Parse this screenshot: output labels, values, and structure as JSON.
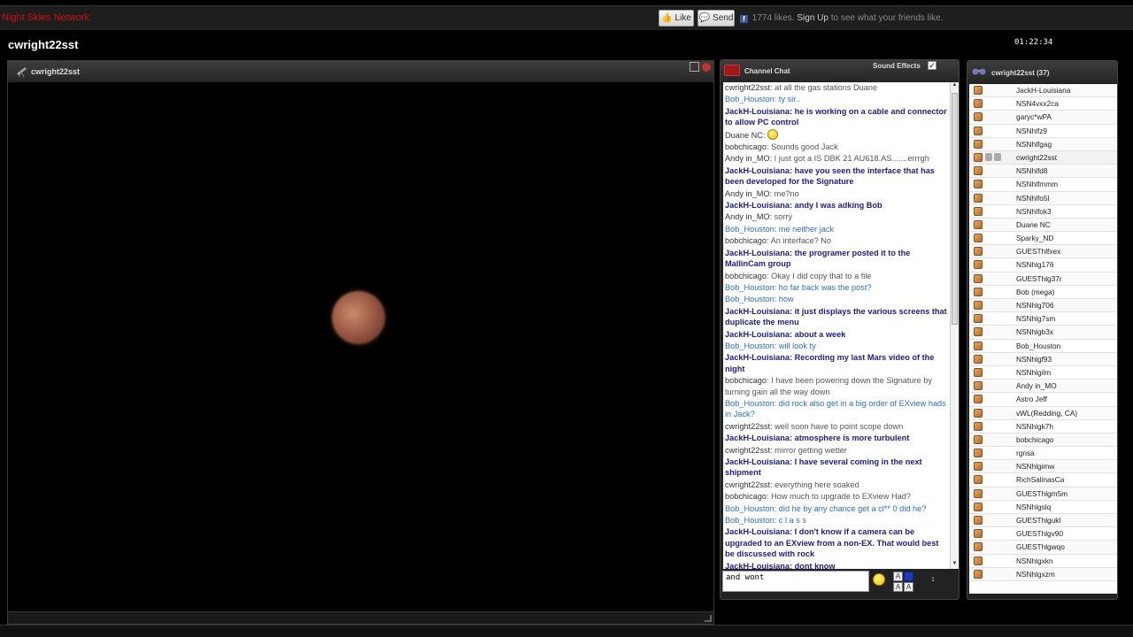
{
  "site_title": "Night Skies Network",
  "topbar": {
    "like_label": "Like",
    "send_label": "Send",
    "likes_text": "1774 likes.",
    "signup_label": "Sign Up",
    "signup_suffix": "to see what your friends like."
  },
  "channel": {
    "name": "cwright22sst",
    "clock": "01:22:34"
  },
  "video": {
    "username": "cwright22sst"
  },
  "chat": {
    "title": "Channel Chat",
    "sound_effects_label": "Sound Effects",
    "sound_effects_checked": "✓",
    "input_value": "and wont",
    "counter": "1",
    "messages": [
      {
        "user": "cwright22sst",
        "text": ": at all the gas stations Duane",
        "style": "dark"
      },
      {
        "user": "Bob_Houston",
        "text": ": ty sir..",
        "style": "blue"
      },
      {
        "user": "JackH-Louisiana",
        "text": ": he is working on a cable and connector to allow PC control",
        "style": "navy"
      },
      {
        "user": "Duane NC",
        "text": ":",
        "style": "dark",
        "emoji": true
      },
      {
        "user": "bobchicago",
        "text": ": Sounds good Jack",
        "style": "dark"
      },
      {
        "user": "Andy in_MO",
        "text": ": I just got a IS DBK 21 AU618.AS.......errrgh",
        "style": "dark"
      },
      {
        "user": "JackH-Louisiana",
        "text": ": have you seen the interface that has been developed for the Signature",
        "style": "navy"
      },
      {
        "user": "Andy in_MO",
        "text": ": me?no",
        "style": "dark"
      },
      {
        "user": "JackH-Louisiana",
        "text": ": andy I was adking Bob",
        "style": "navy"
      },
      {
        "user": "Andy in_MO",
        "text": ": sorry",
        "style": "dark"
      },
      {
        "user": "Bob_Houston",
        "text": ": me neither jack",
        "style": "blue"
      },
      {
        "user": "bobchicago",
        "text": ": An interface? No",
        "style": "dark"
      },
      {
        "user": "JackH-Louisiana",
        "text": ": the programer posted it to the MallinCam group",
        "style": "navy"
      },
      {
        "user": "bobchicago",
        "text": ": Okay I did copy that to a file",
        "style": "dark"
      },
      {
        "user": "Bob_Houston",
        "text": ": ho far back was the post?",
        "style": "blue"
      },
      {
        "user": "Bob_Houston",
        "text": ": how",
        "style": "blue"
      },
      {
        "user": "JackH-Louisiana",
        "text": ": it just displays the various screens that duplicate the menu",
        "style": "navy"
      },
      {
        "user": "JackH-Louisiana",
        "text": ": about a week",
        "style": "navy"
      },
      {
        "user": "Bob_Houston",
        "text": ": will look ty",
        "style": "blue"
      },
      {
        "user": "JackH-Louisiana",
        "text": ": Recording my last Mars video of the night",
        "style": "navy"
      },
      {
        "user": "bobchicago",
        "text": ": I have been powering down the Signature by turning gain all the way down",
        "style": "dark"
      },
      {
        "user": "Bob_Houston",
        "text": ": did rock also get in a big order of EXview hads in Jack?",
        "style": "blue"
      },
      {
        "user": "cwright22sst",
        "text": ": well soon have to point scope down",
        "style": "dark"
      },
      {
        "user": "JackH-Louisiana",
        "text": ": atmosphere is more turbulent",
        "style": "navy"
      },
      {
        "user": "cwright22sst",
        "text": ": mirror getting wetter",
        "style": "dark"
      },
      {
        "user": "JackH-Louisiana",
        "text": ": I have several coming in the next shipment",
        "style": "navy"
      },
      {
        "user": "cwright22sst",
        "text": ": everything here soaked",
        "style": "dark"
      },
      {
        "user": "bobchicago",
        "text": ": How much to upgrade to EXview Had?",
        "style": "dark"
      },
      {
        "user": "Bob_Houston",
        "text": ": did he by any chance get a cl** 0 did he?",
        "style": "blue"
      },
      {
        "user": "Bob_Houston",
        "text": ": c l a s s",
        "style": "blue"
      },
      {
        "user": "JackH-Louisiana",
        "text": ": I don't know if a camera can be upgraded to an EXview from a non-EX. That would best be discussed with rock",
        "style": "navy"
      },
      {
        "user": "JackH-Louisiana",
        "text": ": dont know",
        "style": "navy"
      }
    ]
  },
  "users": {
    "title": "cwright22sst (37)",
    "list": [
      "JackH-Louisiana",
      "NSN4vxx2ca",
      "garyc*wPA",
      "NSNhlfz9",
      "NSNhlfgag",
      "cwright22sst",
      "NSNhlfd8",
      "NSNhlfmmm",
      "NSNhlfo5l",
      "NSNhlfok3",
      "Duane NC",
      "Sparky_ND",
      "GUESThlfxex",
      "NSNhlg176",
      "GUESThlg37r",
      "Bob (mega)",
      "NSNhlg706",
      "NSNhlg7sm",
      "NSNhlgb3x",
      "Bob_Houston",
      "NSNhlgf93",
      "NSNhlgilm",
      "Andy in_MO",
      "Astro Jeff",
      "vWL(Redding, CA)",
      "NSNhlgk7h",
      "bobchicago",
      "rgnsa",
      "NSNhlgimw",
      "RichSalinasCa",
      "GUESThlgm5m",
      "NSNhlgslq",
      "GUESThlgukl",
      "GUESThlgv90",
      "GUESThlgwqo",
      "NSNhlgxkn",
      "NSNhlgxzm"
    ]
  }
}
